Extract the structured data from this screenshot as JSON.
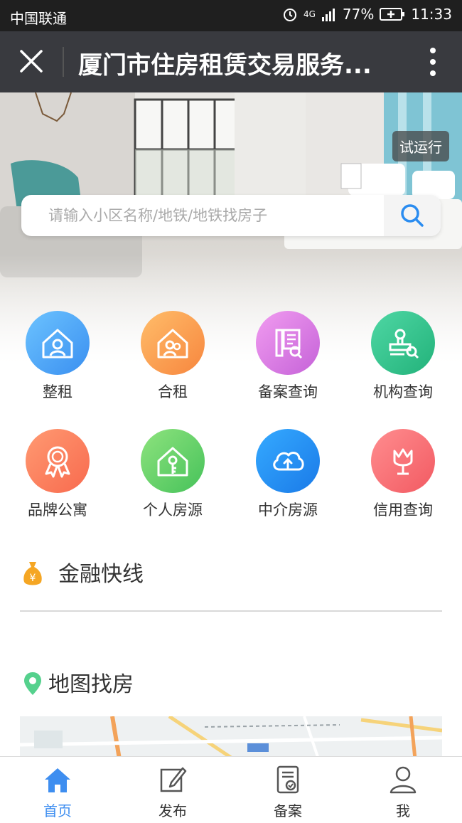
{
  "status_bar": {
    "carrier": "中国联通",
    "network": "4G",
    "battery": "77%",
    "time": "11:33"
  },
  "title_bar": {
    "title": "厦门市住房租赁交易服务..."
  },
  "hero": {
    "badge": "试运行",
    "search_placeholder": "请输入小区名称/地铁/地铁找房子"
  },
  "menu": [
    {
      "label": "整租",
      "icon": "house-person-icon",
      "color": "#4aa8f5"
    },
    {
      "label": "合租",
      "icon": "house-people-icon",
      "color": "#fb9a52"
    },
    {
      "label": "备案查询",
      "icon": "document-search-icon",
      "color": "#d96fe0"
    },
    {
      "label": "机构查询",
      "icon": "stamp-search-icon",
      "color": "#33c48a"
    },
    {
      "label": "品牌公寓",
      "icon": "ribbon-badge-icon",
      "color": "#fb7e5f"
    },
    {
      "label": "个人房源",
      "icon": "house-key-icon",
      "color": "#5fd06a"
    },
    {
      "label": "中介房源",
      "icon": "cloud-upload-icon",
      "color": "#2a8cf0"
    },
    {
      "label": "信用查询",
      "icon": "tulip-icon",
      "color": "#f86a6f"
    }
  ],
  "finance": {
    "title": "金融快线",
    "icon": "money-bag-icon"
  },
  "map_section": {
    "title": "地图找房",
    "icon": "map-pin-icon"
  },
  "tabbar": [
    {
      "label": "首页",
      "icon": "home-icon",
      "active": true
    },
    {
      "label": "发布",
      "icon": "edit-icon",
      "active": false
    },
    {
      "label": "备案",
      "icon": "record-icon",
      "active": false
    },
    {
      "label": "我",
      "icon": "user-icon",
      "active": false
    }
  ]
}
